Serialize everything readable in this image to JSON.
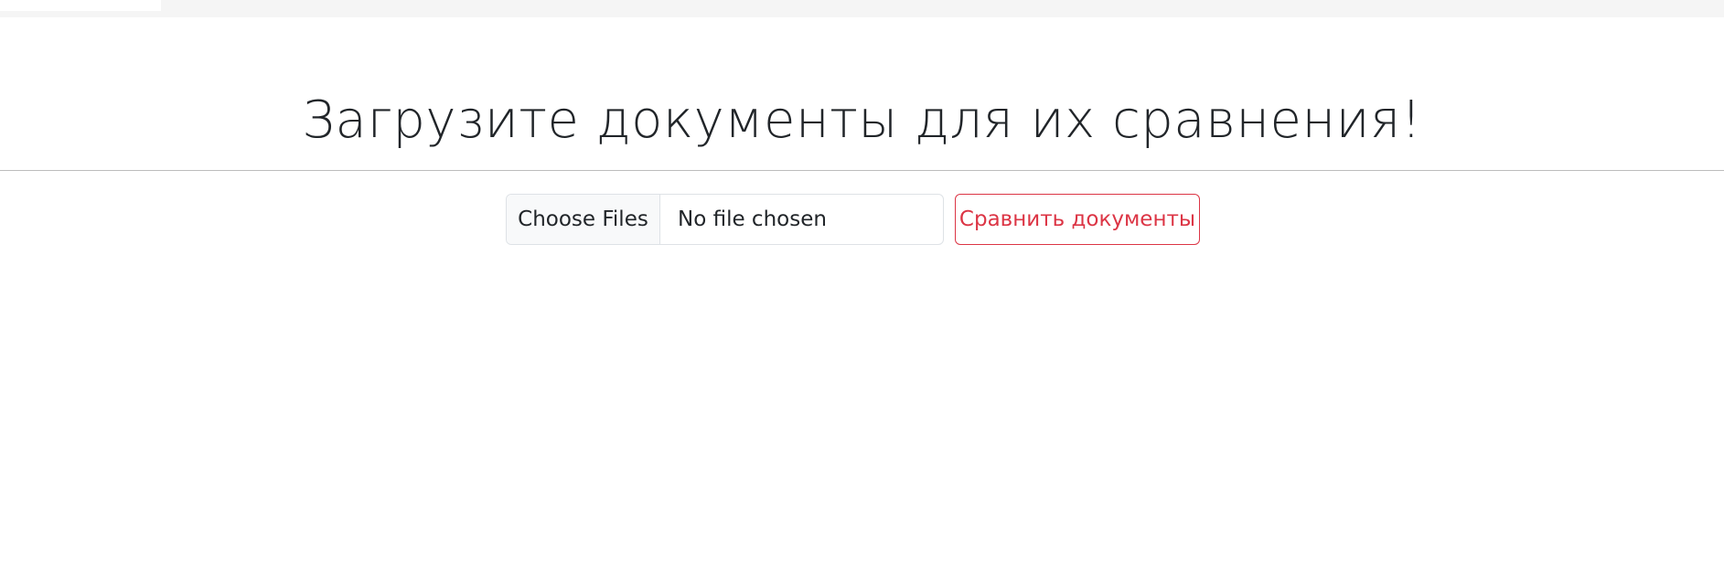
{
  "top_strip": {
    "label": "",
    "background_color": "#f5f5f5"
  },
  "page": {
    "title": "Загрузите документы для их сравнения!"
  },
  "upload": {
    "choose_label": "Choose Files",
    "status_text": "No file chosen",
    "submit_label": "Сравнить документы",
    "accent_color": "#dc3545"
  }
}
